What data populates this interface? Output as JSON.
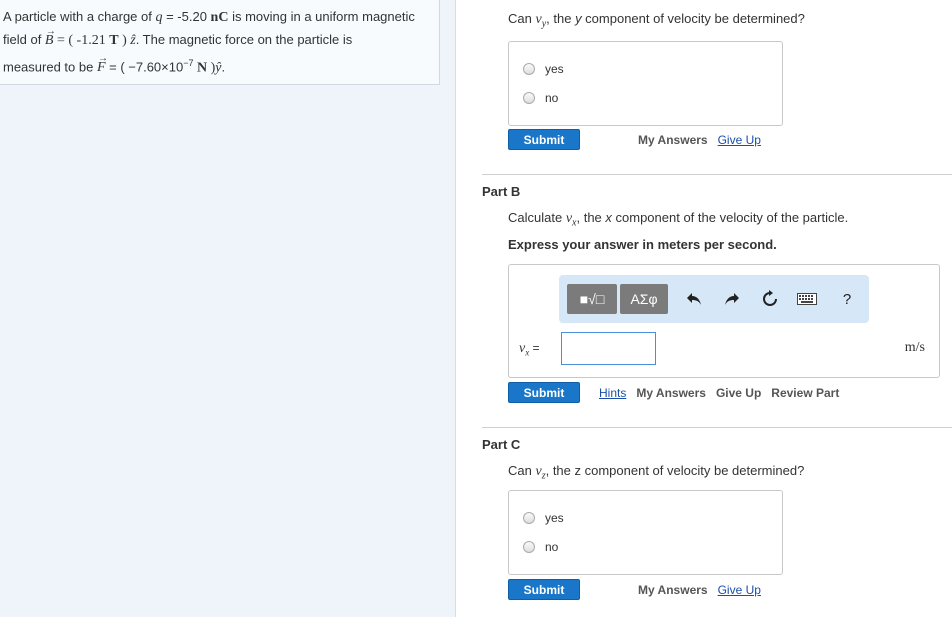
{
  "problem": {
    "text_1": "A particle with a charge of ",
    "q_sym": "q",
    "text_2": " = -5.20 ",
    "q_unit": "nC",
    "text_3": " is moving in a uniform magnetic",
    "text_4": "field of ",
    "B_sym": "B",
    "text_5": " = ( -1.21 ",
    "B_unit": "T",
    "text_6": " ) ",
    "z_hat": "ẑ",
    "text_7": ". The magnetic force on the particle is",
    "text_8": "measured to be ",
    "F_sym": "F",
    "text_9": " = ( −7.60×10",
    "F_exp": "−7",
    "F_unit": " N ",
    "text_10": ")",
    "y_hat": "ŷ",
    "text_11": "."
  },
  "partA": {
    "question_pre": "Can ",
    "question_var": "v",
    "question_sub": "y",
    "question_post": ", the ",
    "question_axis": "y",
    "question_end": " component of velocity be determined?",
    "options": [
      "yes",
      "no"
    ],
    "submit": "Submit",
    "my_answers": "My Answers",
    "give_up": "Give Up"
  },
  "partB": {
    "title": "Part B",
    "question_pre": "Calculate ",
    "question_var": "v",
    "question_sub": "x",
    "question_post": ", the ",
    "question_axis": "x",
    "question_end": " component of the velocity of the particle.",
    "express": "Express your answer in meters per second.",
    "toolbar": {
      "templates": "■√□",
      "symbols": "ΑΣφ",
      "help": "?"
    },
    "var_label": "v",
    "var_sub": "x",
    "var_eq": " =",
    "input_value": "",
    "unit": "m/s",
    "submit": "Submit",
    "hints": "Hints",
    "my_answers": "My Answers",
    "give_up": "Give Up",
    "review_part": "Review Part"
  },
  "partC": {
    "title": "Part C",
    "question_pre": "Can ",
    "question_var": "v",
    "question_sub": "z",
    "question_post": ", the z component of velocity be determined?",
    "options": [
      "yes",
      "no"
    ],
    "submit": "Submit",
    "my_answers": "My Answers",
    "give_up": "Give Up"
  },
  "icons": {
    "undo": "undo-icon",
    "redo": "redo-icon",
    "reset": "reset-icon",
    "keyboard": "keyboard-icon"
  },
  "colors": {
    "accent": "#1a76c8",
    "link": "#1a4fa8",
    "left_panel": "#eef4fa"
  }
}
